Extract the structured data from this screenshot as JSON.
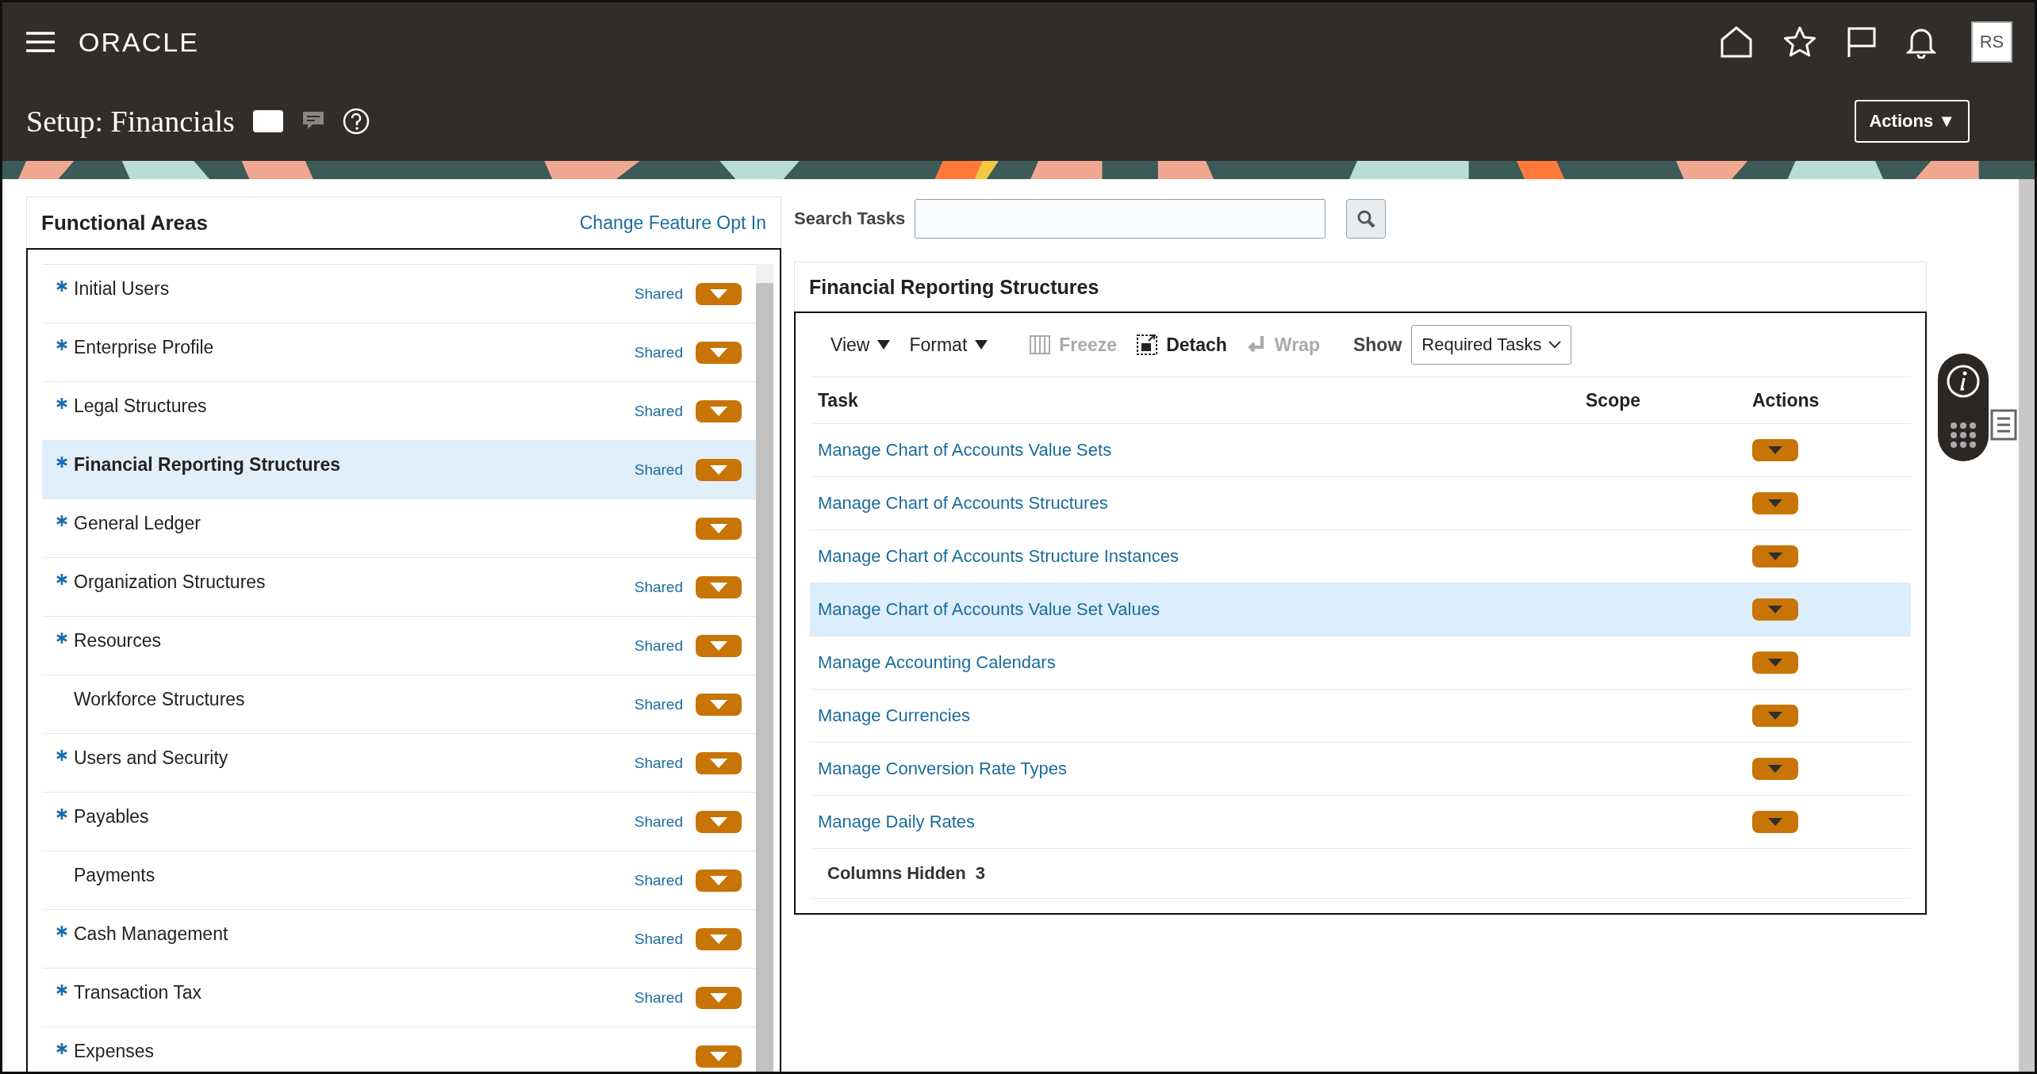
{
  "header": {
    "logo": "ORACLE",
    "avatar": "RS",
    "page_title": "Setup: Financials",
    "actions_button": "Actions ▼"
  },
  "functional_areas": {
    "title": "Functional Areas",
    "link": "Change Feature Opt In",
    "items": [
      {
        "label": "Initial Users",
        "required": true,
        "shared": "Shared",
        "selected": false
      },
      {
        "label": "Enterprise Profile",
        "required": true,
        "shared": "Shared",
        "selected": false
      },
      {
        "label": "Legal Structures",
        "required": true,
        "shared": "Shared",
        "selected": false
      },
      {
        "label": "Financial Reporting Structures",
        "required": true,
        "shared": "Shared",
        "selected": true
      },
      {
        "label": "General Ledger",
        "required": true,
        "selected": false
      },
      {
        "label": "Organization Structures",
        "required": true,
        "shared": "Shared",
        "selected": false
      },
      {
        "label": "Resources",
        "required": true,
        "shared": "Shared",
        "selected": false
      },
      {
        "label": "Workforce Structures",
        "required": false,
        "shared": "Shared",
        "selected": false
      },
      {
        "label": "Users and Security",
        "required": true,
        "shared": "Shared",
        "selected": false
      },
      {
        "label": "Payables",
        "required": true,
        "shared": "Shared",
        "selected": false
      },
      {
        "label": "Payments",
        "required": false,
        "shared": "Shared",
        "selected": false
      },
      {
        "label": "Cash Management",
        "required": true,
        "shared": "Shared",
        "selected": false
      },
      {
        "label": "Transaction Tax",
        "required": true,
        "shared": "Shared",
        "selected": false
      },
      {
        "label": "Expenses",
        "required": true,
        "selected": false
      }
    ]
  },
  "search": {
    "label": "Search Tasks"
  },
  "tasks_panel": {
    "title": "Financial Reporting Structures",
    "toolbar": [
      {
        "label": "View",
        "kind": "menu",
        "disabled": false
      },
      {
        "label": "Format",
        "kind": "menu",
        "disabled": false
      },
      {
        "label": "Freeze",
        "kind": "freeze",
        "disabled": true
      },
      {
        "label": "Detach",
        "kind": "detach",
        "disabled": false
      },
      {
        "label": "Wrap",
        "kind": "wrap",
        "disabled": true
      }
    ],
    "show_label": "Show",
    "show_value": "Required Tasks",
    "columns": [
      "Task",
      "Scope",
      "Actions"
    ],
    "rows": [
      {
        "task": "Manage Chart of Accounts Value Sets",
        "selected": false
      },
      {
        "task": "Manage Chart of Accounts Structures",
        "selected": false
      },
      {
        "task": "Manage Chart of Accounts Structure Instances",
        "selected": false
      },
      {
        "task": "Manage Chart of Accounts Value Set Values",
        "selected": true
      },
      {
        "task": "Manage Accounting Calendars",
        "selected": false
      },
      {
        "task": "Manage Currencies",
        "selected": false
      },
      {
        "task": "Manage Conversion Rate Types",
        "selected": false
      },
      {
        "task": "Manage Daily Rates",
        "selected": false
      }
    ],
    "columns_hidden_label": "Columns Hidden",
    "columns_hidden_count": "3"
  }
}
